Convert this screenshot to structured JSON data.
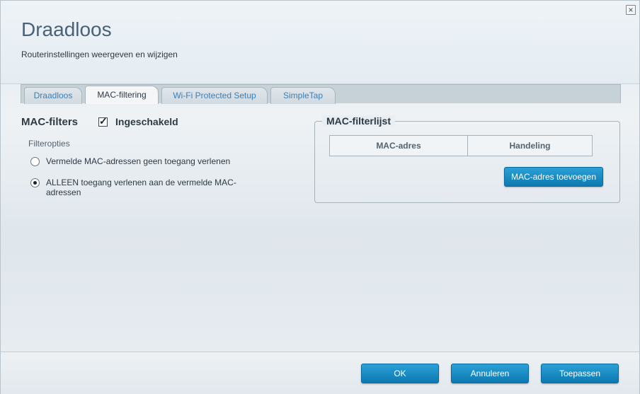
{
  "header": {
    "title": "Draadloos",
    "subtitle": "Routerinstellingen weergeven en wijzigen"
  },
  "tabs": [
    {
      "label": "Draadloos",
      "active": false
    },
    {
      "label": "MAC-filtering",
      "active": true
    },
    {
      "label": "Wi-Fi Protected Setup",
      "active": false
    },
    {
      "label": "SimpleTap",
      "active": false
    }
  ],
  "mac_filters": {
    "label": "MAC-filters",
    "enabled_label": "Ingeschakeld",
    "enabled": true,
    "filter_options_label": "Filteropties",
    "options": [
      {
        "label": "Vermelde MAC-adressen geen toegang verlenen",
        "selected": false
      },
      {
        "label": "ALLEEN toegang verlenen aan de vermelde MAC-adressen",
        "selected": true
      }
    ]
  },
  "filter_list": {
    "legend": "MAC-filterlijst",
    "columns": [
      "MAC-adres",
      "Handeling"
    ],
    "add_button": "MAC-adres toevoegen"
  },
  "footer": {
    "ok": "OK",
    "cancel": "Annuleren",
    "apply": "Toepassen"
  },
  "colors": {
    "accent": "#1a8cc6",
    "title": "#4a6275",
    "link": "#3a7fb7"
  }
}
